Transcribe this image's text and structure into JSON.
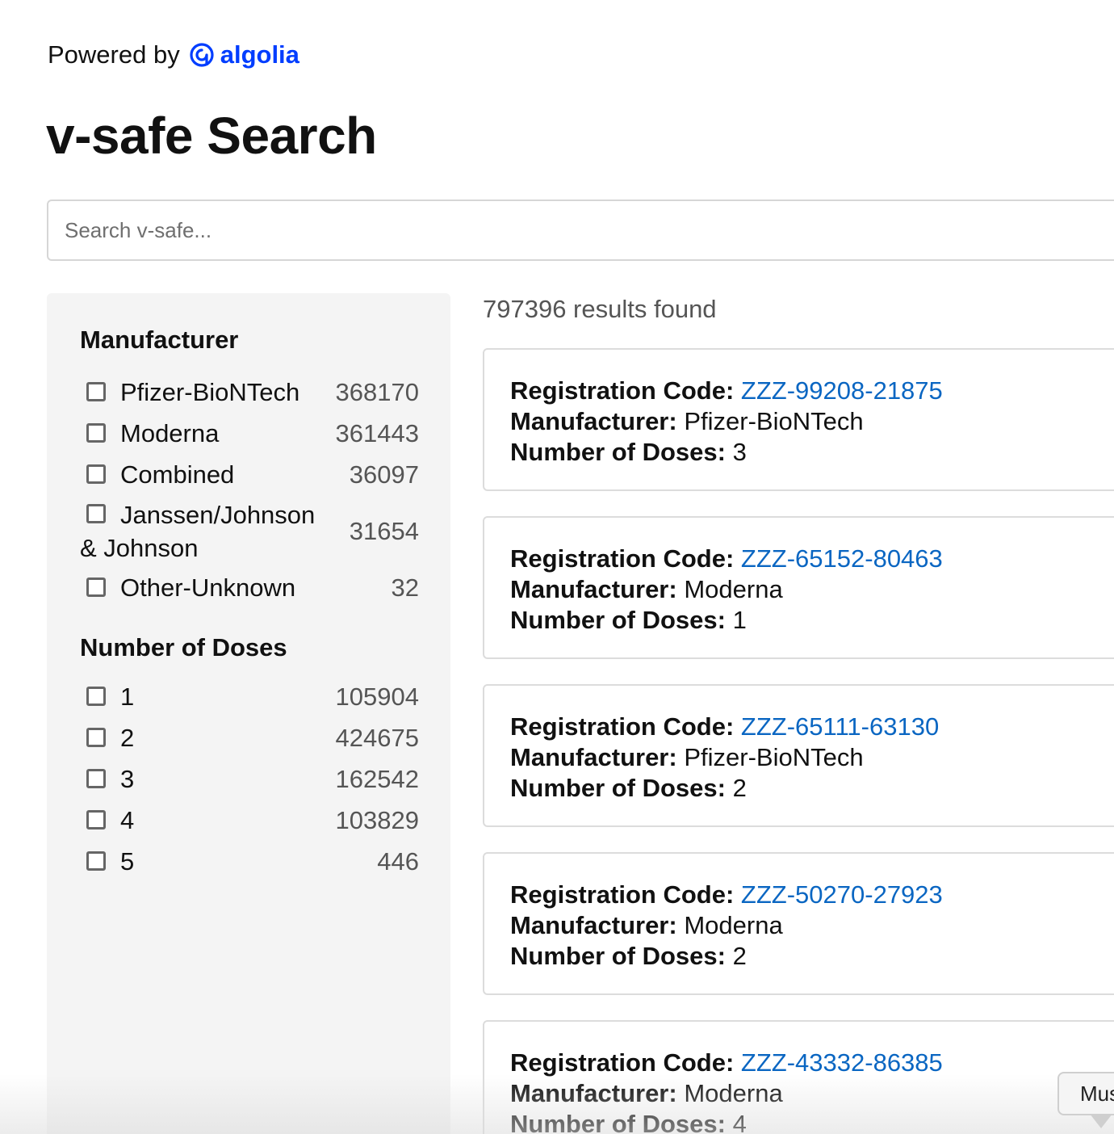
{
  "header": {
    "powered_by": "Powered by",
    "brand": "algolia",
    "brand_color": "#003dff",
    "title": "v-safe Search"
  },
  "search": {
    "value": "",
    "placeholder": "Search v-safe..."
  },
  "facets": {
    "manufacturer": {
      "title": "Manufacturer",
      "items": [
        {
          "label": "Pfizer-BioNTech",
          "count": "368170",
          "checked": false
        },
        {
          "label": "Moderna",
          "count": "361443",
          "checked": false
        },
        {
          "label": "Combined",
          "count": "36097",
          "checked": false
        },
        {
          "label": "Janssen/Johnson & Johnson",
          "count": "31654",
          "checked": false
        },
        {
          "label": "Other-Unknown",
          "count": "32",
          "checked": false
        }
      ]
    },
    "doses": {
      "title": "Number of Doses",
      "items": [
        {
          "label": "1",
          "count": "105904",
          "checked": false
        },
        {
          "label": "2",
          "count": "424675",
          "checked": false
        },
        {
          "label": "3",
          "count": "162542",
          "checked": false
        },
        {
          "label": "4",
          "count": "103829",
          "checked": false
        },
        {
          "label": "5",
          "count": "446",
          "checked": false
        }
      ]
    }
  },
  "results": {
    "count_text": "797396 results found",
    "labels": {
      "code": "Registration Code:",
      "manufacturer": "Manufacturer:",
      "doses": "Number of Doses:"
    },
    "link_color": "#0a66c2",
    "hits": [
      {
        "code": "ZZZ-99208-21875",
        "manufacturer": "Pfizer-BioNTech",
        "doses": "3"
      },
      {
        "code": "ZZZ-65152-80463",
        "manufacturer": "Moderna",
        "doses": "1"
      },
      {
        "code": "ZZZ-65111-63130",
        "manufacturer": "Pfizer-BioNTech",
        "doses": "2"
      },
      {
        "code": "ZZZ-50270-27923",
        "manufacturer": "Moderna",
        "doses": "2"
      },
      {
        "code": "ZZZ-43332-86385",
        "manufacturer": "Moderna",
        "doses": "4"
      }
    ]
  },
  "tooltip": {
    "text": "Mus"
  }
}
